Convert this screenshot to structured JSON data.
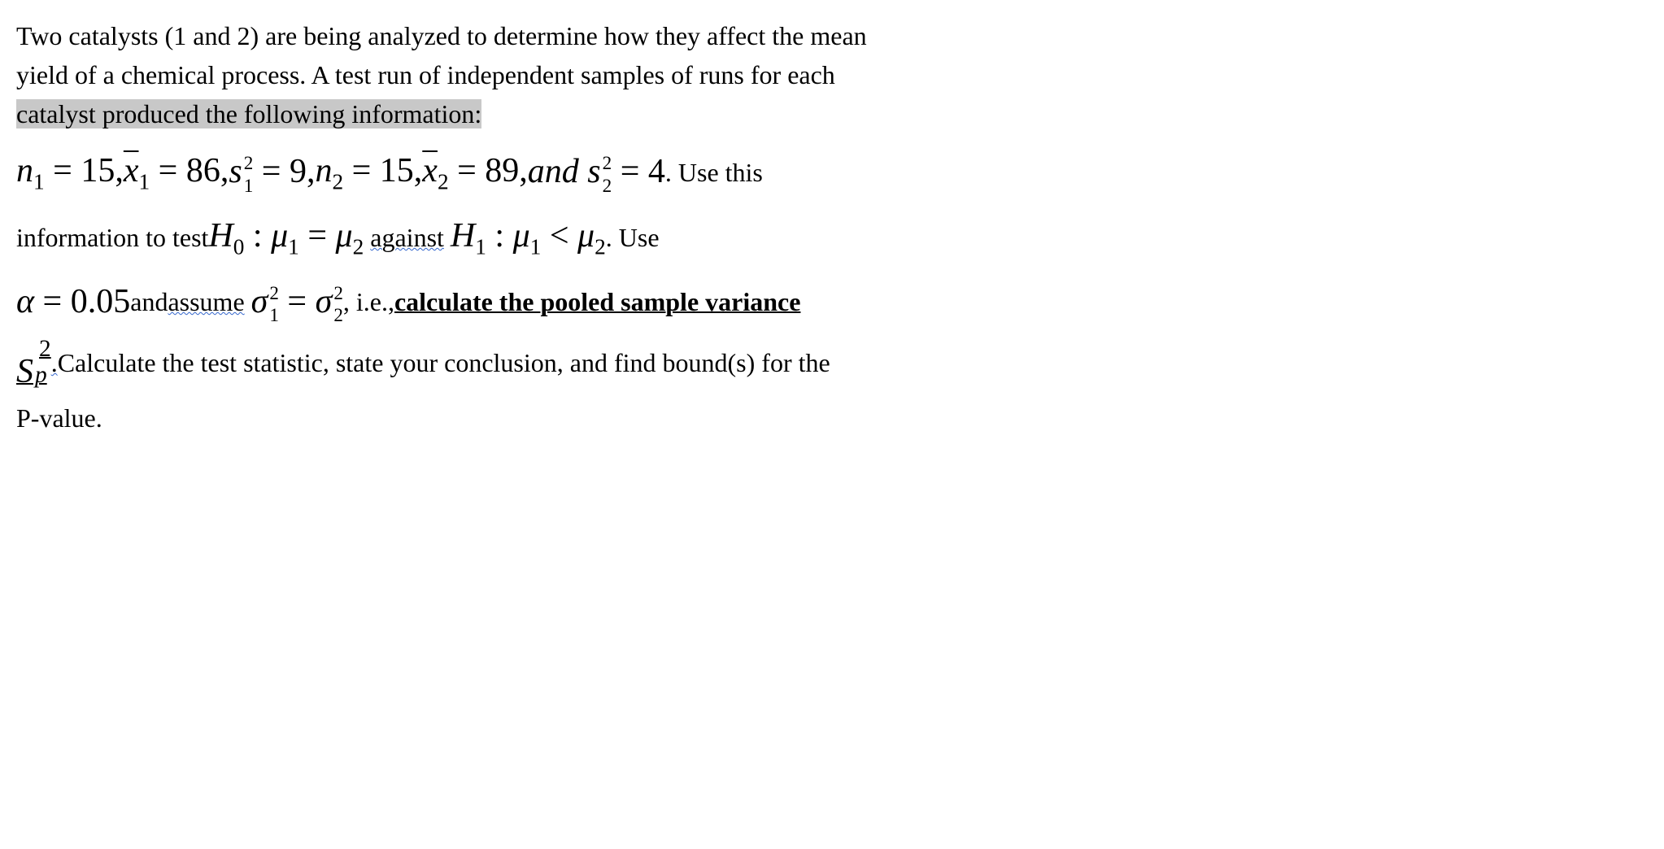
{
  "problem": {
    "intro_line1": "Two catalysts (1 and 2) are being analyzed to determine how they affect the mean",
    "intro_line2": "yield of a chemical process.  A test run of independent samples of runs for each",
    "intro_highlighted": "catalyst produced the following information:",
    "stats": {
      "n1_var": "n",
      "n1_sub": "1",
      "eq": " = ",
      "n1_val": "15",
      "xbar1_var": "x",
      "xbar1_sub": "1",
      "xbar1_val": "86",
      "s1_var": "s",
      "s1_sup": "2",
      "s1_sub": "1",
      "s1_val": "9",
      "n2_var": "n",
      "n2_sub": "2",
      "n2_val": "15",
      "xbar2_var": "x",
      "xbar2_sub": "2",
      "xbar2_val": "89",
      "and": "and",
      "s2_var": "s",
      "s2_sup": "2",
      "s2_sub": "2",
      "s2_val": "4",
      "trailing": ".  Use this"
    },
    "hypothesis": {
      "prefix": "information to test ",
      "H0": "H",
      "zero": "0",
      "colon": " : ",
      "mu": "μ",
      "one": "1",
      "two": "2",
      "against": "against",
      "H1": "H",
      "lt": " < ",
      "suffix": ".  Use"
    },
    "alpha_line": {
      "alpha": "α",
      "eq": " = ",
      "alpha_val": "0.05",
      "and_assume": " and ",
      "assume": "assume",
      "sigma": "σ",
      "one": "1",
      "two": "2",
      "sup2": "2",
      "ie": " , i.e., ",
      "calc": "calculate the pooled sample variance"
    },
    "sp_line": {
      "S": "S",
      "p": "p",
      "two": "2",
      "dot": " .",
      "rest": "  Calculate the test statistic, state your conclusion, and find bound(s) for the"
    },
    "pvalue": "P-value."
  }
}
